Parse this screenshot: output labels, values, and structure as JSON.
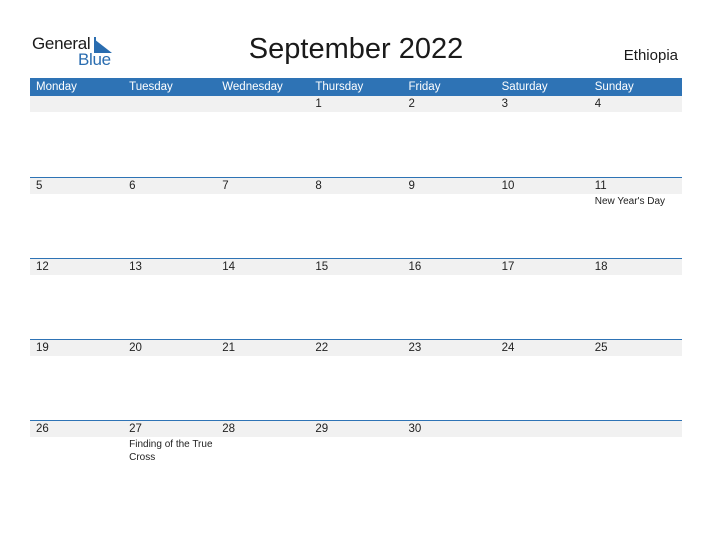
{
  "logo": {
    "line1": "General",
    "line2": "Blue",
    "accent": "#2a6db0"
  },
  "title": "September 2022",
  "country": "Ethiopia",
  "colors": {
    "header_bg": "#2e73b5",
    "date_strip": "#f1f1f1"
  },
  "weekdays": [
    "Monday",
    "Tuesday",
    "Wednesday",
    "Thursday",
    "Friday",
    "Saturday",
    "Sunday"
  ],
  "weeks": [
    {
      "days": [
        {
          "num": "",
          "holiday": ""
        },
        {
          "num": "",
          "holiday": ""
        },
        {
          "num": "",
          "holiday": ""
        },
        {
          "num": "1",
          "holiday": ""
        },
        {
          "num": "2",
          "holiday": ""
        },
        {
          "num": "3",
          "holiday": ""
        },
        {
          "num": "4",
          "holiday": ""
        }
      ]
    },
    {
      "days": [
        {
          "num": "5",
          "holiday": ""
        },
        {
          "num": "6",
          "holiday": ""
        },
        {
          "num": "7",
          "holiday": ""
        },
        {
          "num": "8",
          "holiday": ""
        },
        {
          "num": "9",
          "holiday": ""
        },
        {
          "num": "10",
          "holiday": ""
        },
        {
          "num": "11",
          "holiday": "New Year's Day"
        }
      ]
    },
    {
      "days": [
        {
          "num": "12",
          "holiday": ""
        },
        {
          "num": "13",
          "holiday": ""
        },
        {
          "num": "14",
          "holiday": ""
        },
        {
          "num": "15",
          "holiday": ""
        },
        {
          "num": "16",
          "holiday": ""
        },
        {
          "num": "17",
          "holiday": ""
        },
        {
          "num": "18",
          "holiday": ""
        }
      ]
    },
    {
      "days": [
        {
          "num": "19",
          "holiday": ""
        },
        {
          "num": "20",
          "holiday": ""
        },
        {
          "num": "21",
          "holiday": ""
        },
        {
          "num": "22",
          "holiday": ""
        },
        {
          "num": "23",
          "holiday": ""
        },
        {
          "num": "24",
          "holiday": ""
        },
        {
          "num": "25",
          "holiday": ""
        }
      ]
    },
    {
      "days": [
        {
          "num": "26",
          "holiday": ""
        },
        {
          "num": "27",
          "holiday": "Finding of the True Cross"
        },
        {
          "num": "28",
          "holiday": ""
        },
        {
          "num": "29",
          "holiday": ""
        },
        {
          "num": "30",
          "holiday": ""
        },
        {
          "num": "",
          "holiday": ""
        },
        {
          "num": "",
          "holiday": ""
        }
      ]
    }
  ]
}
